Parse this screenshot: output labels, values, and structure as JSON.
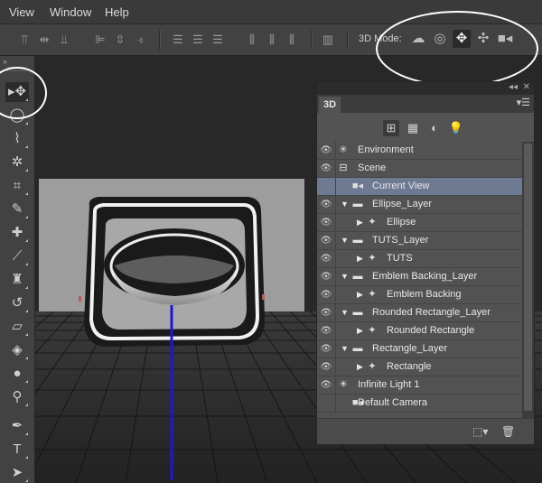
{
  "menu": {
    "items": [
      "View",
      "Window",
      "Help"
    ]
  },
  "options_bar": {
    "mode_label": "3D Mode:",
    "align_icons": [
      "align-top-icon",
      "align-vcenter-icon",
      "align-bottom-icon",
      "align-left-icon",
      "align-hcenter-icon",
      "align-right-icon"
    ],
    "distribute_icons": [
      "distribute-top-icon",
      "distribute-vcenter-icon",
      "distribute-bottom-icon",
      "distribute-left-icon",
      "distribute-hcenter-icon",
      "distribute-right-icon"
    ],
    "modes": [
      "rotate-3d-icon",
      "roll-3d-icon",
      "drag-3d-icon",
      "slide-3d-icon",
      "scale-3d-icon"
    ],
    "active_mode": "drag-3d-icon"
  },
  "toolbar": {
    "collapse": "»",
    "tools": [
      "move-tool-icon",
      "elliptical-marquee-icon",
      "polygonal-lasso-icon",
      "magic-wand-icon",
      "crop-icon",
      "eyedropper-icon",
      "spot-healing-icon",
      "brush-icon",
      "clone-stamp-icon",
      "history-brush-icon",
      "eraser-icon",
      "paint-bucket-icon",
      "blur-icon",
      "dodge-icon",
      "pen-icon",
      "type-icon",
      "path-select-icon"
    ],
    "active_tool": "move-tool-icon"
  },
  "panel": {
    "tab": "3D",
    "collapse_glyph": "◂◂",
    "close_glyph": "✕",
    "filters": [
      "whole-scene-filter-icon",
      "meshes-filter-icon",
      "materials-filter-icon",
      "lights-filter-icon"
    ],
    "layers": [
      {
        "label": "Environment",
        "indent": 0,
        "arrow": "",
        "icon": "environment-icon"
      },
      {
        "label": "Scene",
        "indent": 0,
        "arrow": "",
        "icon": "scene-icon"
      },
      {
        "label": "Current View",
        "indent": 1,
        "arrow": "",
        "icon": "camera-icon",
        "selected": true
      },
      {
        "label": "Ellipse_Layer",
        "indent": 0,
        "arrow": "▼",
        "icon": "folder-icon"
      },
      {
        "label": "Ellipse",
        "indent": 1,
        "arrow": "▶",
        "icon": "mesh-icon"
      },
      {
        "label": "TUTS_Layer",
        "indent": 0,
        "arrow": "▼",
        "icon": "folder-icon"
      },
      {
        "label": "TUTS",
        "indent": 1,
        "arrow": "▶",
        "icon": "mesh-icon"
      },
      {
        "label": "Emblem Backing_Layer",
        "indent": 0,
        "arrow": "▼",
        "icon": "folder-icon"
      },
      {
        "label": "Emblem Backing",
        "indent": 1,
        "arrow": "▶",
        "icon": "mesh-icon"
      },
      {
        "label": "Rounded Rectangle_Layer",
        "indent": 0,
        "arrow": "▼",
        "icon": "folder-icon"
      },
      {
        "label": "Rounded Rectangle",
        "indent": 1,
        "arrow": "▶",
        "icon": "mesh-icon"
      },
      {
        "label": "Rectangle_Layer",
        "indent": 0,
        "arrow": "▼",
        "icon": "folder-icon"
      },
      {
        "label": "Rectangle",
        "indent": 1,
        "arrow": "▶",
        "icon": "mesh-icon"
      },
      {
        "label": "Infinite Light 1",
        "indent": 0,
        "arrow": "",
        "icon": "light-icon"
      },
      {
        "label": "Default Camera",
        "indent": 1,
        "arrow": "",
        "icon": "camera-icon"
      }
    ],
    "bottom": [
      "new-light-icon",
      "delete-icon"
    ]
  }
}
